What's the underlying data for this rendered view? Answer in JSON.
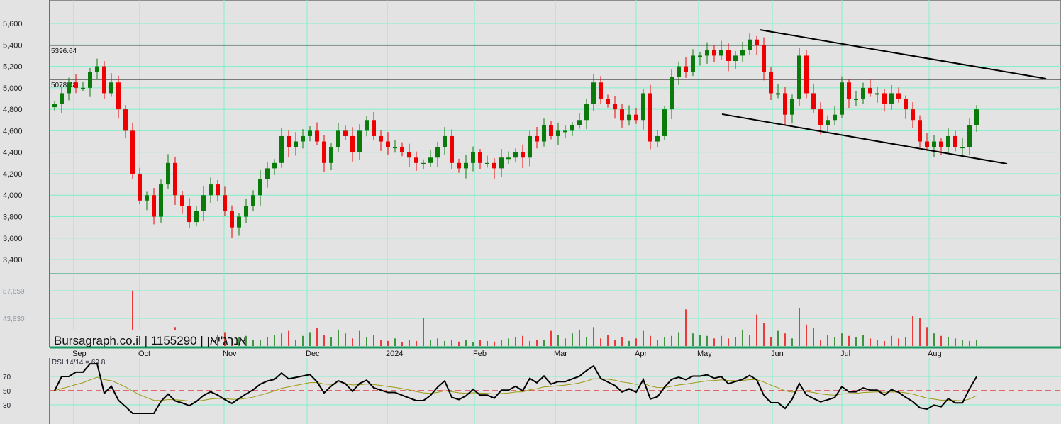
{
  "chart_data": {
    "type": "candlestick",
    "title": "Bursagraph.co.il | 1155290 | אנרג'יאן",
    "watermark": "Bursagraph.co.il",
    "security_id": "1155290",
    "security_name": "אנרג'יאן",
    "ylim": [
      3300,
      5750
    ],
    "y_ticks": [
      "5,600",
      "5,400",
      "5,200",
      "5,000",
      "4,800",
      "4,600",
      "4,400",
      "4,200",
      "4,000",
      "3,800",
      "3,600",
      "3,400"
    ],
    "y_tick_values": [
      5600,
      5400,
      5200,
      5000,
      4800,
      4600,
      4400,
      4200,
      4000,
      3800,
      3600,
      3400
    ],
    "levels": [
      {
        "label": "5396.64",
        "value": 5396.64
      },
      {
        "label": "5078.48",
        "value": 5078.48
      }
    ],
    "months": [
      {
        "label": "Sep",
        "index": 2.7
      },
      {
        "label": "Oct",
        "index": 12
      },
      {
        "label": "Nov",
        "index": 23.9
      },
      {
        "label": "Dec",
        "index": 35.6
      },
      {
        "label": "2024",
        "index": 46.9
      },
      {
        "label": "Feb",
        "index": 59.2
      },
      {
        "label": "Mar",
        "index": 70.6
      },
      {
        "label": "Apr",
        "index": 82
      },
      {
        "label": "May",
        "index": 90.8
      },
      {
        "label": "Jun",
        "index": 101.2
      },
      {
        "label": "Jul",
        "index": 111
      },
      {
        "label": "Aug",
        "index": 123.3
      }
    ],
    "close": [
      4850,
      4950,
      5050,
      5000,
      5000,
      5150,
      5200,
      4950,
      5050,
      4800,
      4600,
      4200,
      3950,
      4000,
      3800,
      4100,
      4300,
      4000,
      3900,
      3750,
      3850,
      4000,
      4100,
      4000,
      3850,
      3700,
      3800,
      3900,
      4000,
      4150,
      4250,
      4300,
      4550,
      4450,
      4500,
      4550,
      4600,
      4500,
      4300,
      4450,
      4600,
      4550,
      4400,
      4600,
      4700,
      4550,
      4500,
      4450,
      4450,
      4400,
      4350,
      4300,
      4300,
      4350,
      4450,
      4550,
      4300,
      4250,
      4300,
      4400,
      4300,
      4300,
      4250,
      4350,
      4350,
      4400,
      4350,
      4550,
      4500,
      4650,
      4550,
      4600,
      4600,
      4650,
      4700,
      4850,
      5050,
      4900,
      4850,
      4800,
      4700,
      4750,
      4700,
      4950,
      4500,
      4550,
      4800,
      5100,
      5200,
      5150,
      5300,
      5300,
      5350,
      5300,
      5350,
      5250,
      5300,
      5350,
      5450,
      5400,
      5150,
      4950,
      4950,
      4750,
      4900,
      5300,
      4950,
      4800,
      4650,
      4700,
      4750,
      5050,
      4900,
      4900,
      5000,
      4950,
      4950,
      4850,
      4950,
      4900,
      4800,
      4700,
      4500,
      4450,
      4500,
      4450,
      4550,
      4450,
      4450,
      4650,
      4800
    ],
    "volume_axis": {
      "ticks": [
        "87,659",
        "43,830"
      ],
      "values": [
        87659,
        43830
      ]
    },
    "volume": [
      3000,
      14000,
      8000,
      22000,
      9000,
      12000,
      6000,
      10000,
      4000,
      8000,
      7000,
      88000,
      20000,
      15000,
      10000,
      9000,
      12000,
      30000,
      14000,
      9000,
      6000,
      8000,
      14000,
      18000,
      22000,
      12000,
      14000,
      16000,
      10000,
      9000,
      14000,
      18000,
      20000,
      24000,
      10000,
      16000,
      22000,
      28000,
      18000,
      14000,
      26000,
      20000,
      12000,
      24000,
      14000,
      18000,
      10000,
      8000,
      12000,
      6000,
      10000,
      8000,
      44000,
      9000,
      12000,
      8000,
      10000,
      7000,
      9000,
      6000,
      9000,
      8000,
      7000,
      10000,
      12000,
      14000,
      16000,
      8000,
      10000,
      9000,
      24000,
      18000,
      12000,
      20000,
      26000,
      14000,
      30000,
      12000,
      18000,
      10000,
      14000,
      8000,
      12000,
      24000,
      16000,
      10000,
      14000,
      16000,
      22000,
      58000,
      20000,
      18000,
      16000,
      12000,
      16000,
      12000,
      14000,
      26000,
      18000,
      50000,
      36000,
      14000,
      24000,
      20000,
      12000,
      60000,
      34000,
      28000,
      10000,
      18000,
      14000,
      20000,
      16000,
      14000,
      18000,
      12000,
      10000,
      8000,
      16000,
      12000,
      14000,
      48000,
      44000,
      30000,
      20000,
      16000,
      14000,
      12000,
      10000,
      8000,
      9000
    ],
    "rsi": {
      "label": "RSI 14/14 = 69.8",
      "ticks": [
        "70",
        "50",
        "30"
      ],
      "values": [
        70,
        50,
        30
      ],
      "last": 69.8
    },
    "trendlines": [
      {
        "name": "upper",
        "from": {
          "index": 99.5,
          "value": 5540
        },
        "to": {
          "index": 139.8,
          "value": 5085
        }
      },
      {
        "name": "lower",
        "from": {
          "index": 94.1,
          "value": 4755
        },
        "to": {
          "index": 134.3,
          "value": 4292
        }
      }
    ],
    "colors": {
      "up": "#0a7a0a",
      "down": "#ee0000",
      "grid": "#7ff0c8",
      "bg": "#e3e3e3",
      "pane_border": "#1a9a60"
    }
  }
}
